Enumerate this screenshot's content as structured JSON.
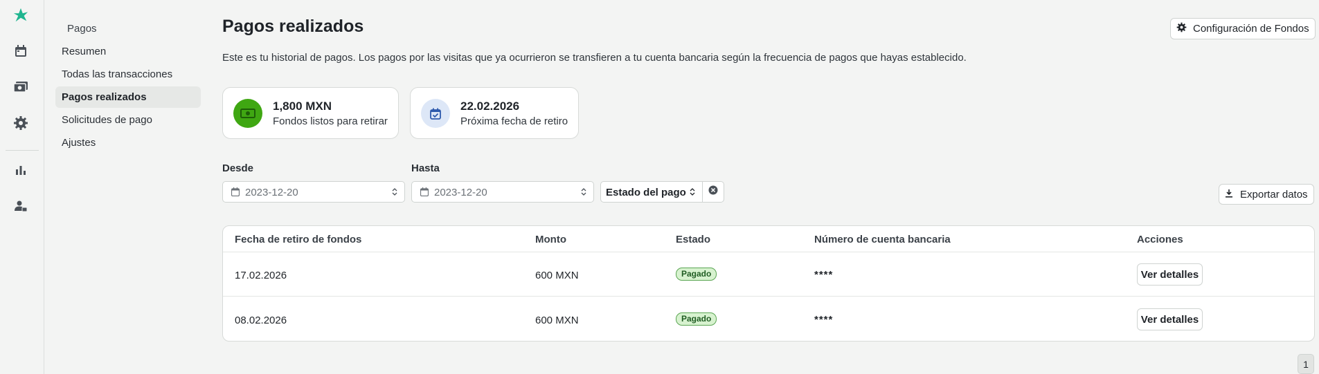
{
  "rail": {
    "icons": [
      "logo-icon",
      "calendar-icon",
      "payments-icon",
      "settings-icon",
      "analytics-icon",
      "staff-icon"
    ]
  },
  "submenu": {
    "heading": "Pagos",
    "items": [
      {
        "label": "Resumen"
      },
      {
        "label": "Todas las transacciones"
      },
      {
        "label": "Pagos realizados",
        "active": true
      },
      {
        "label": "Solicitudes de pago"
      },
      {
        "label": "Ajustes"
      }
    ]
  },
  "header": {
    "title": "Pagos realizados",
    "description": "Este es tu historial de pagos. Los pagos por las visitas que ya ocurrieron se transfieren a tu cuenta bancaria según la frecuencia de pagos que hayas establecido.",
    "config_button": "Configuración de Fondos"
  },
  "cards": [
    {
      "value": "1,800 MXN",
      "label": "Fondos listos para retirar",
      "icon": "cash-icon"
    },
    {
      "value": "22.02.2026",
      "label": "Próxima fecha de retiro",
      "icon": "calendar-check-icon"
    }
  ],
  "filters": {
    "from_label": "Desde",
    "from_value": "2023-12-20",
    "to_label": "Hasta",
    "to_value": "2023-12-20",
    "status_label": "Estado del pago",
    "export_button": "Exportar datos"
  },
  "table": {
    "headers": [
      "Fecha de retiro de fondos",
      "Monto",
      "Estado",
      "Número de cuenta bancaria",
      "Acciones"
    ],
    "rows": [
      {
        "date": "17.02.2026",
        "amount": "600 MXN",
        "status": "Pagado",
        "account": "****",
        "action": "Ver detalles"
      },
      {
        "date": "08.02.2026",
        "amount": "600 MXN",
        "status": "Pagado",
        "account": "****",
        "action": "Ver detalles"
      }
    ]
  },
  "pagination": {
    "current_page": "1"
  },
  "colors": {
    "brand": "#1fb58f",
    "success_green": "#3fa712",
    "badge_bg": "#d7f2cf",
    "calendar_circle": "#dde7f7"
  }
}
